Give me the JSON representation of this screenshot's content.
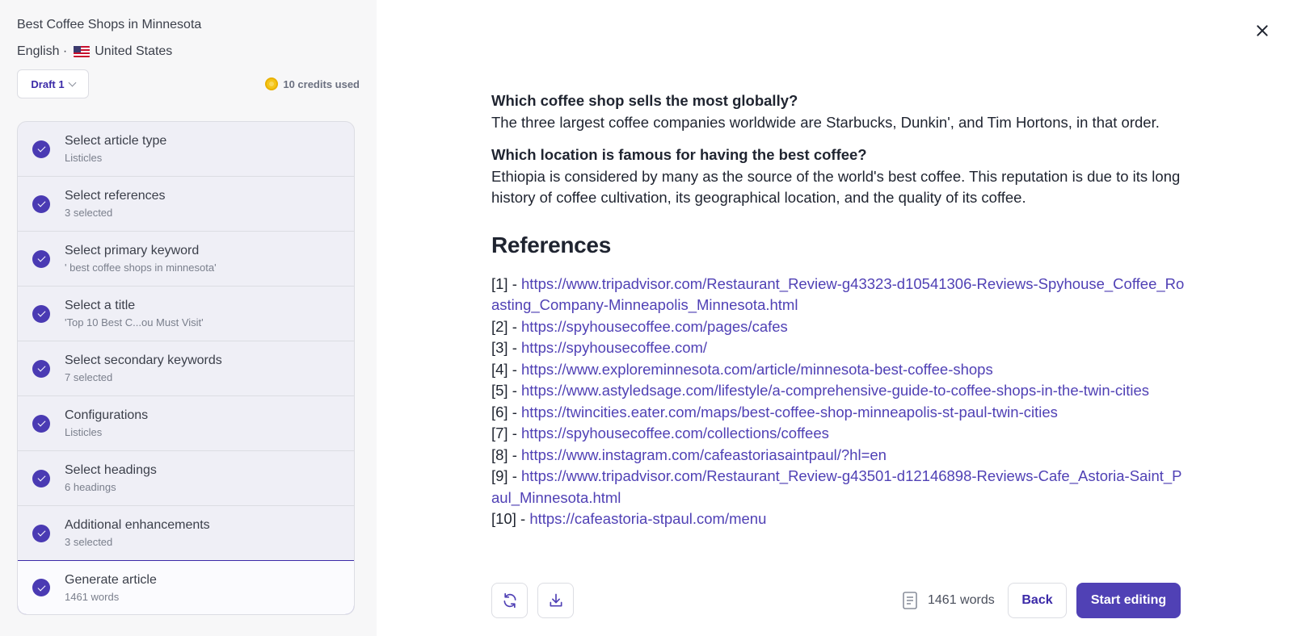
{
  "sidebar": {
    "doc_title": "Best Coffee Shops in Minnesota",
    "language": "English ·",
    "country": "United States",
    "draft_label": "Draft 1",
    "credits_label": "10 credits used",
    "steps": [
      {
        "title": "Select article type",
        "sub": "Listicles"
      },
      {
        "title": "Select references",
        "sub": "3 selected"
      },
      {
        "title": "Select primary keyword",
        "sub": "' best coffee shops in minnesota'"
      },
      {
        "title": "Select a title",
        "sub": "'Top 10 Best C...ou Must Visit'"
      },
      {
        "title": "Select secondary keywords",
        "sub": "7 selected"
      },
      {
        "title": "Configurations",
        "sub": "Listicles"
      },
      {
        "title": "Select headings",
        "sub": "6 headings"
      },
      {
        "title": "Additional enhancements",
        "sub": "3 selected"
      },
      {
        "title": "Generate article",
        "sub": "1461 words"
      }
    ]
  },
  "article": {
    "faq": [
      {
        "q": "Which coffee shop sells the most globally?",
        "a": "The three largest coffee companies worldwide are Starbucks, Dunkin', and Tim Hortons, in that order."
      },
      {
        "q": "Which location is famous for having the best coffee?",
        "a": "Ethiopia is considered by many as the source of the world's best coffee. This reputation is due to its long history of coffee cultivation, its geographical location, and the quality of its coffee."
      }
    ],
    "references_heading": "References",
    "references": [
      {
        "num": "[1] - ",
        "url": "https://www.tripadvisor.com/Restaurant_Review-g43323-d10541306-Reviews-Spyhouse_Coffee_Roasting_Company-Minneapolis_Minnesota.html"
      },
      {
        "num": "[2] - ",
        "url": "https://spyhousecoffee.com/pages/cafes"
      },
      {
        "num": "[3] - ",
        "url": "https://spyhousecoffee.com/"
      },
      {
        "num": "[4] - ",
        "url": "https://www.exploreminnesota.com/article/minnesota-best-coffee-shops"
      },
      {
        "num": "[5] - ",
        "url": "https://www.astyledsage.com/lifestyle/a-comprehensive-guide-to-coffee-shops-in-the-twin-cities"
      },
      {
        "num": "[6] - ",
        "url": "https://twincities.eater.com/maps/best-coffee-shop-minneapolis-st-paul-twin-cities"
      },
      {
        "num": "[7] - ",
        "url": "https://spyhousecoffee.com/collections/coffees"
      },
      {
        "num": "[8] - ",
        "url": "https://www.instagram.com/cafeastoriasaintpaul/?hl=en"
      },
      {
        "num": "[9] - ",
        "url": "https://www.tripadvisor.com/Restaurant_Review-g43501-d12146898-Reviews-Cafe_Astoria-Saint_Paul_Minnesota.html"
      },
      {
        "num": "[10] - ",
        "url": "https://cafeastoria-stpaul.com/menu"
      }
    ]
  },
  "footer": {
    "word_count": "1461 words",
    "back_label": "Back",
    "start_label": "Start editing"
  },
  "colors": {
    "accent": "#5041b5",
    "sidebar_bg": "#f7f7f8",
    "link": "#5041b5"
  },
  "icons": [
    "check-circle-icon",
    "chevron-down-icon",
    "coin-icon",
    "us-flag-icon",
    "close-icon",
    "refresh-icon",
    "download-icon",
    "document-icon"
  ]
}
